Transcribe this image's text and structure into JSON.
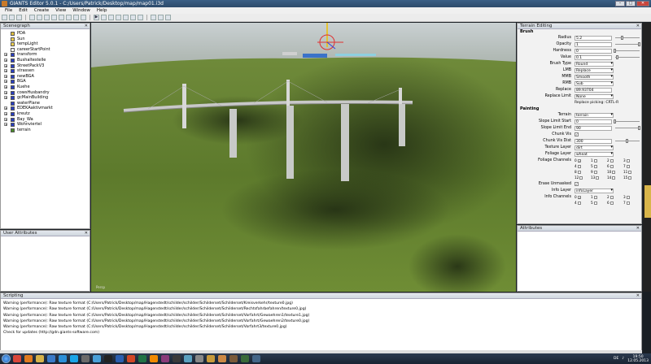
{
  "window": {
    "title": "GIANTS Editor 5.0.1 - C:/Users/Patrick/Desktop/map/map01.i3d"
  },
  "menu": [
    "File",
    "Edit",
    "Create",
    "View",
    "Window",
    "Help"
  ],
  "scenegraph": {
    "title": "Scenegraph",
    "items": [
      {
        "label": "PDA",
        "icon_color": "#e0c040",
        "expandable": false
      },
      {
        "label": "Sun",
        "icon_color": "#f0d050",
        "expandable": false
      },
      {
        "label": "tempLight",
        "icon_color": "#f0d050",
        "expandable": false
      },
      {
        "label": "careerStartPoint",
        "icon_color": "#ffffff",
        "expandable": false
      },
      {
        "label": "transform",
        "icon_color": "#2a3fbf",
        "expandable": true
      },
      {
        "label": "Bushaltestelle",
        "icon_color": "#2a3fbf",
        "expandable": true
      },
      {
        "label": "StreetPackV3",
        "icon_color": "#2a3fbf",
        "expandable": true
      },
      {
        "label": "strassen",
        "icon_color": "#2a3fbf",
        "expandable": true
      },
      {
        "label": "newBGA",
        "icon_color": "#2a3fbf",
        "expandable": true
      },
      {
        "label": "BGA",
        "icon_color": "#2a3fbf",
        "expandable": true
      },
      {
        "label": "Kuehe",
        "icon_color": "#2a3fbf",
        "expandable": true
      },
      {
        "label": "cowsHusbandry",
        "icon_color": "#2a3fbf",
        "expandable": true
      },
      {
        "label": "gcMainBuilding",
        "icon_color": "#2a3fbf",
        "expandable": true
      },
      {
        "label": "waterPlane",
        "icon_color": "#2a3fbf",
        "expandable": false
      },
      {
        "label": "EDEKAaktivmarkt",
        "icon_color": "#2a3fbf",
        "expandable": true
      },
      {
        "label": "kreutz",
        "icon_color": "#2a3fbf",
        "expandable": true
      },
      {
        "label": "Bay_Wa",
        "icon_color": "#2a3fbf",
        "expandable": true
      },
      {
        "label": "Wohnviertel",
        "icon_color": "#2a3fbf",
        "expandable": true
      },
      {
        "label": "terrain",
        "icon_color": "#4a8a2a",
        "expandable": false
      }
    ]
  },
  "user_attributes": {
    "title": "User Attributes"
  },
  "viewport": {
    "label": "Persp"
  },
  "terrain_editing": {
    "title": "Terrain Editing",
    "brush_section": "Brush",
    "radius": {
      "label": "Radius",
      "value": "5.2",
      "level": 0.3
    },
    "opacity": {
      "label": "Opacity",
      "value": "1",
      "level": 1.0
    },
    "hardness": {
      "label": "Hardness",
      "value": "0",
      "level": 0.0
    },
    "value": {
      "label": "Value",
      "value": "0.1",
      "level": 0.1
    },
    "brush_type": {
      "label": "Brush Type",
      "value": "Round"
    },
    "lmb": {
      "label": "LMB",
      "value": "Replace"
    },
    "mmb": {
      "label": "MMB",
      "value": "Smooth"
    },
    "rmb": {
      "label": "RMB",
      "value": "Sub"
    },
    "replace": {
      "label": "Replace",
      "value": "89.93704"
    },
    "replace_limit": {
      "label": "Replace Limit",
      "value": "None"
    },
    "replace_picking": "Replace picking: CRTL-R",
    "painting_section": "Painting",
    "terrain": {
      "label": "Terrain",
      "value": "terrain"
    },
    "slope_start": {
      "label": "Slope Limit Start",
      "value": "0",
      "level": 0.0
    },
    "slope_end": {
      "label": "Slope Limit End",
      "value": "90",
      "level": 1.0
    },
    "chunk_vis": {
      "label": "Chunk Vis",
      "checked": true
    },
    "chunk_vis_dist": {
      "label": "Chunk Vis Dist",
      "value": "300",
      "level": 0.5
    },
    "texture_layer": {
      "label": "Texture Layer",
      "value": "dirt"
    },
    "foliage_layer": {
      "label": "Foliage Layer",
      "value": "wheat"
    },
    "foliage_channels": {
      "label": "Foliage Channels",
      "channels": [
        "0",
        "1",
        "2",
        "3",
        "4",
        "5",
        "6",
        "7",
        "8",
        "9",
        "10",
        "11",
        "12",
        "13",
        "14",
        "15"
      ],
      "checked": [
        "0"
      ]
    },
    "erase_unmasked": {
      "label": "Erase Unmasked",
      "checked": true
    },
    "info_layer": {
      "label": "Info Layer",
      "value": "infoLayer"
    },
    "info_channels": {
      "label": "Info Channels",
      "channels": [
        "0",
        "1",
        "2",
        "3",
        "4",
        "5",
        "6",
        "7"
      ],
      "checked": [
        "0"
      ]
    }
  },
  "attributes": {
    "title": "Attributes"
  },
  "scripting": {
    "title": "Scripting",
    "lines": [
      "Warning (performance): Raw texture format (C:/Users/Patrick/Desktop/map/Hagenstedt/schilder/schilder/Schilderset/Schilderset/Kreisverkehr/texture0.jpg)",
      "Warning (performance): Raw texture format (C:/Users/Patrick/Desktop/map/Hagenstedt/schilder/schilder/Schilderset/Schilderset/Rechtsfahrbefahren/texture0.jpg)",
      "Warning (performance): Raw texture format (C:/Users/Patrick/Desktop/map/Hagenstedt/schilder/schilder/Schilderset/Schilderset/Vorfahrt/Gewaehren1/texture1.jpg)",
      "Warning (performance): Raw texture format (C:/Users/Patrick/Desktop/map/Hagenstedt/schilder/schilder/Schilderset/Schilderset/Vorfahrt/Gewaehren2/texture0.jpg)",
      "Warning (performance): Raw texture format (C:/Users/Patrick/Desktop/map/Hagenstedt/schilder/schilder/Schilderset/Schilderset/Vorfahrt3/texture0.jpg)",
      "Check for updates (http://gdn.giants-software.com)"
    ]
  },
  "taskbar": {
    "apps": [
      {
        "icon": "chrome-icon",
        "color": "#d9463a"
      },
      {
        "icon": "firefox-icon",
        "color": "#e07a1f"
      },
      {
        "icon": "explorer-icon",
        "color": "#d7b34a"
      },
      {
        "icon": "media-icon",
        "color": "#3a79c7"
      },
      {
        "icon": "app-icon",
        "color": "#2b8fd8"
      },
      {
        "icon": "skype-icon",
        "color": "#1aa5e8"
      },
      {
        "icon": "app-icon",
        "color": "#6a6a6a"
      },
      {
        "icon": "app-icon",
        "color": "#4aa0d8"
      },
      {
        "icon": "app-icon",
        "color": "#222222"
      },
      {
        "icon": "word-icon",
        "color": "#2b5fb0"
      },
      {
        "icon": "powerpoint-icon",
        "color": "#d24726"
      },
      {
        "icon": "excel-icon",
        "color": "#207245"
      },
      {
        "icon": "vlc-icon",
        "color": "#f08a00"
      },
      {
        "icon": "winrar-icon",
        "color": "#8a3b7a"
      },
      {
        "icon": "app-icon",
        "color": "#3a3a3a"
      },
      {
        "icon": "app-icon",
        "color": "#5aa0c0"
      },
      {
        "icon": "app-icon",
        "color": "#888888"
      },
      {
        "icon": "app-icon",
        "color": "#c89a3a"
      },
      {
        "icon": "app-icon",
        "color": "#cc8844"
      },
      {
        "icon": "app-icon",
        "color": "#7a5a3a"
      },
      {
        "icon": "app-icon",
        "color": "#3a6a3a"
      },
      {
        "icon": "app-icon",
        "color": "#446688"
      }
    ],
    "lang": "DE",
    "time": "19:50",
    "date": "12.05.2013"
  }
}
